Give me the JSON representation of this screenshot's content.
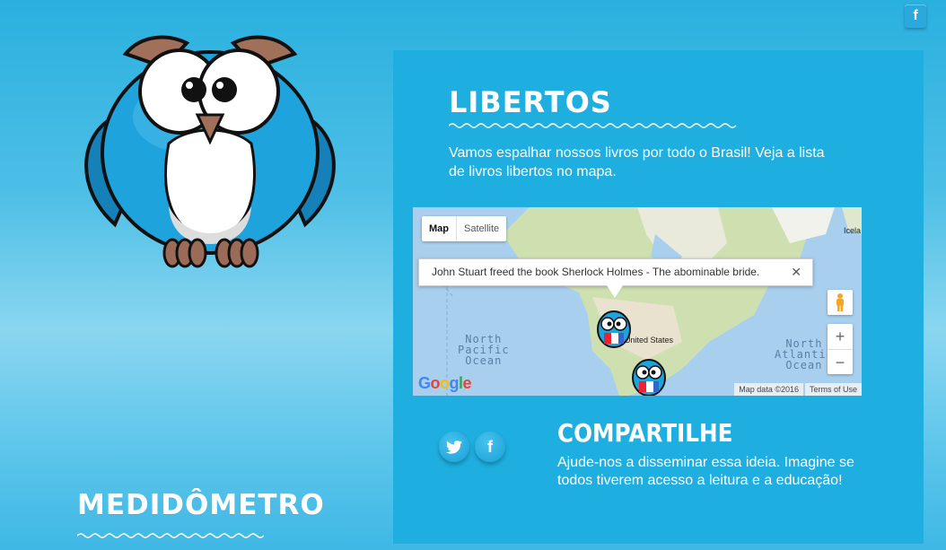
{
  "social_top": {
    "facebook_glyph": "f"
  },
  "logo": {
    "text": "MEDIDÔMETRO"
  },
  "section": {
    "title": "LIBERTOS",
    "intro": "Vamos espalhar nossos livros por todo o Brasil! Veja a lista de livros libertos no mapa."
  },
  "map": {
    "type_buttons": [
      "Map",
      "Satellite"
    ],
    "selected_type": "Map",
    "infowindow_text": "John Stuart freed the book Sherlock Holmes - The abominable bride.",
    "close_glyph": "✕",
    "zoom_in": "+",
    "zoom_out": "−",
    "labels": {
      "north_pacific": "North\nPacific\nOcean",
      "north_atlantic": "North\nAtlantic\nOcean",
      "united_states": "United States",
      "iceland": "Icela"
    },
    "google_logo": "Google",
    "attribution": [
      "Map data ©2016",
      "Terms of Use"
    ]
  },
  "share": {
    "twitter_icon": "twitter-icon",
    "facebook_glyph": "f",
    "title": "COMPARTILHE",
    "text": "Ajude-nos a disseminar essa ideia. Imagine se todos tiverem acesso a leitura e a educação!"
  },
  "colors": {
    "panel": "#1eaedf",
    "owl_blue": "#1ea3dc",
    "owl_dark": "#1680b8"
  }
}
